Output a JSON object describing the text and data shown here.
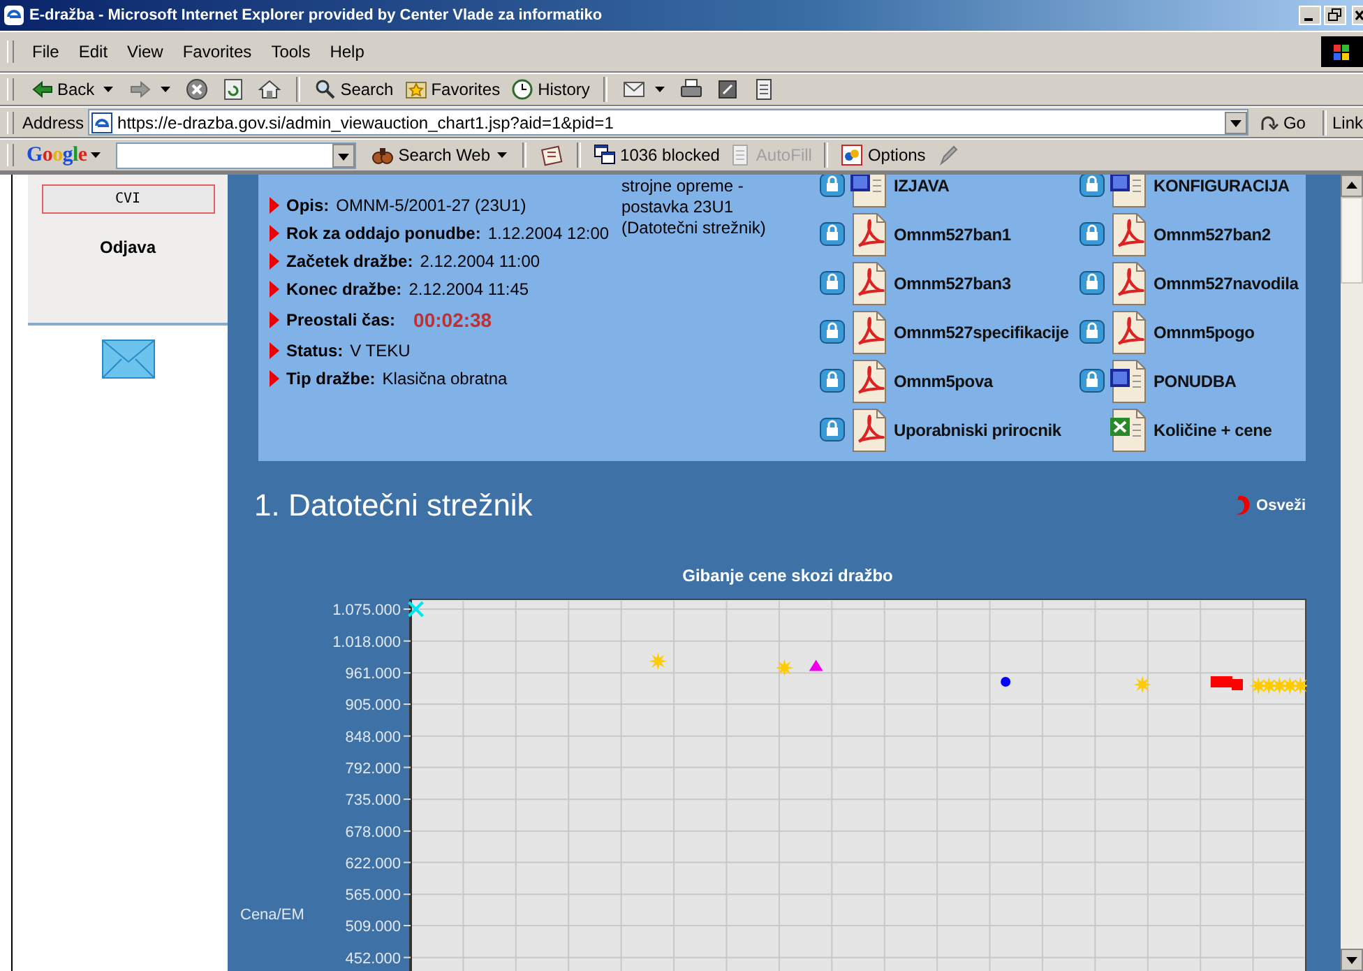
{
  "window": {
    "title": "E-dražba - Microsoft Internet Explorer provided by Center Vlade za informatiko"
  },
  "menu": [
    "File",
    "Edit",
    "View",
    "Favorites",
    "Tools",
    "Help"
  ],
  "toolbar": [
    {
      "kind": "back",
      "label": "Back"
    },
    {
      "kind": "forward"
    },
    {
      "kind": "stop"
    },
    {
      "kind": "refresh"
    },
    {
      "kind": "home"
    },
    {
      "kind": "search",
      "label": "Search"
    },
    {
      "kind": "favorites",
      "label": "Favorites"
    },
    {
      "kind": "history",
      "label": "History"
    },
    {
      "kind": "mail"
    },
    {
      "kind": "print"
    },
    {
      "kind": "edit"
    },
    {
      "kind": "discuss"
    }
  ],
  "address_bar": {
    "label": "Address",
    "value": "https://e-drazba.gov.si/admin_viewauction_chart1.jsp?aid=1&pid=1",
    "go": "Go",
    "links": "Link"
  },
  "google_bar": {
    "logo": "Google",
    "items": [
      {
        "kind": "search",
        "label": "Search Web",
        "disabled": false
      },
      {
        "kind": "news",
        "disabled": false
      },
      {
        "kind": "popup",
        "label": "1036 blocked",
        "disabled": false
      },
      {
        "kind": "autofill",
        "label": "AutoFill",
        "disabled": true
      },
      {
        "kind": "options",
        "label": "Options",
        "disabled": false
      },
      {
        "kind": "highlight",
        "disabled": false
      }
    ]
  },
  "sidebar": {
    "button": "CVI",
    "link": "Odjava"
  },
  "auction": {
    "fields": [
      {
        "kind": "text",
        "label": "Opis:",
        "value": "OMNM-5/2001-27 (23U1)"
      },
      {
        "kind": "text",
        "label": "Rok za oddajo ponudbe:",
        "value": "1.12.2004 12:00"
      },
      {
        "kind": "text",
        "label": "Začetek dražbe:",
        "value": "2.12.2004 11:00"
      },
      {
        "kind": "text",
        "label": "Konec dražbe:",
        "value": "2.12.2004 11:45"
      },
      {
        "kind": "timer",
        "label": "Preostali čas:",
        "value": "00:02:38"
      },
      {
        "kind": "text",
        "label": "Status:",
        "value": "V TEKU"
      },
      {
        "kind": "text",
        "label": "Tip dražbe:",
        "value": "Klasična obratna"
      }
    ],
    "description_lines": [
      "strojne opreme -",
      "postavka 23U1",
      "(Datotečni strežnik)"
    ],
    "documents": [
      {
        "name": "IZJAVA",
        "kind": "word",
        "locked": true
      },
      {
        "name": "KONFIGURACIJA",
        "kind": "word",
        "locked": true
      },
      {
        "name": "Omnm527ban1",
        "kind": "pdf",
        "locked": true
      },
      {
        "name": "Omnm527ban2",
        "kind": "pdf",
        "locked": true
      },
      {
        "name": "Omnm527ban3",
        "kind": "pdf",
        "locked": true
      },
      {
        "name": "Omnm527navodila",
        "kind": "pdf",
        "locked": true
      },
      {
        "name": "Omnm527specifikacije",
        "kind": "pdf",
        "locked": true
      },
      {
        "name": "Omnm5pogo",
        "kind": "pdf",
        "locked": true
      },
      {
        "name": "Omnm5pova",
        "kind": "pdf",
        "locked": true
      },
      {
        "name": "PONUDBA",
        "kind": "word",
        "locked": true
      },
      {
        "name": "Uporabniski prirocnik",
        "kind": "pdf",
        "locked": true
      },
      {
        "name": "Količine + cene",
        "kind": "excel",
        "locked": false
      }
    ]
  },
  "section": {
    "title": "1. Datotečni strežnik",
    "refresh": "Osveži",
    "chart_data": {
      "type": "scatter",
      "title": "Gibanje cene skozi dražbo",
      "ylabel": "Cena/EM",
      "ylim": [
        0,
        1092500
      ],
      "grid": true,
      "categories": [
        null,
        null,
        null,
        null,
        null,
        null,
        null,
        null,
        null,
        null,
        null,
        null,
        null,
        null,
        null,
        null,
        null,
        null,
        null,
        null,
        null,
        null,
        null,
        null,
        null,
        null,
        null,
        null,
        null,
        null,
        null,
        null,
        null,
        null,
        null,
        null,
        null,
        null,
        null,
        null,
        null,
        null,
        null,
        null,
        null,
        null,
        null,
        null,
        null,
        null,
        null,
        null,
        null,
        null,
        null,
        null,
        null,
        null,
        null,
        null,
        null,
        null,
        null,
        null,
        null,
        null,
        null,
        null,
        null,
        null,
        null,
        null,
        null,
        null,
        null,
        null,
        null,
        null,
        null,
        null,
        null,
        null,
        null,
        null,
        null
      ],
      "yticks": [
        {
          "value": 1075000,
          "label": "1.075.000"
        },
        {
          "value": 1018000,
          "label": "1.018.000"
        },
        {
          "value": 961000,
          "label": "961.000"
        },
        {
          "value": 905000,
          "label": "905.000"
        },
        {
          "value": 848000,
          "label": "848.000"
        },
        {
          "value": 792000,
          "label": "792.000"
        },
        {
          "value": 735000,
          "label": "735.000"
        },
        {
          "value": 678000,
          "label": "678.000"
        },
        {
          "value": 622000,
          "label": "622.000"
        },
        {
          "value": 565000,
          "label": "565.000"
        },
        {
          "value": 509000,
          "label": "509.000"
        },
        {
          "value": 452000,
          "label": "452.000"
        }
      ],
      "series": [
        {
          "color": "#00e5ee",
          "marker": "cross",
          "values": [
            1075000,
            null,
            null,
            null,
            null,
            null,
            null,
            null,
            null,
            null,
            null,
            null,
            null,
            null,
            null,
            null,
            null,
            null,
            null,
            null,
            null,
            null,
            null,
            null,
            null,
            null,
            null,
            null,
            null,
            null,
            null,
            null,
            null,
            null,
            null,
            null,
            null,
            null,
            null,
            null,
            null,
            null,
            null,
            null,
            null,
            null,
            null,
            null,
            null,
            null,
            null,
            null,
            null,
            null,
            null,
            null,
            null,
            null,
            null,
            null,
            null,
            null,
            null,
            null,
            null,
            null,
            null,
            null,
            null,
            null,
            null,
            null,
            null,
            null,
            null,
            null,
            null,
            null,
            null,
            null,
            null,
            null,
            null,
            null,
            null
          ]
        },
        {
          "color": "#ffcc00",
          "marker": "star",
          "values": [
            null,
            null,
            null,
            null,
            null,
            null,
            null,
            null,
            null,
            null,
            null,
            null,
            null,
            null,
            null,
            null,
            null,
            null,
            null,
            null,
            null,
            null,
            null,
            982000,
            null,
            null,
            null,
            null,
            null,
            null,
            null,
            null,
            null,
            null,
            null,
            970000,
            null,
            null,
            null,
            null,
            null,
            null,
            null,
            null,
            null,
            null,
            null,
            null,
            null,
            null,
            null,
            null,
            null,
            null,
            null,
            null,
            null,
            null,
            null,
            null,
            null,
            null,
            null,
            null,
            null,
            null,
            null,
            null,
            null,
            940000,
            null,
            null,
            null,
            null,
            null,
            null,
            null,
            null,
            null,
            null,
            938000,
            938000,
            938000,
            938000,
            938000
          ]
        },
        {
          "color": "#ee00ee",
          "marker": "triangle",
          "values": [
            null,
            null,
            null,
            null,
            null,
            null,
            null,
            null,
            null,
            null,
            null,
            null,
            null,
            null,
            null,
            null,
            null,
            null,
            null,
            null,
            null,
            null,
            null,
            null,
            null,
            null,
            null,
            null,
            null,
            null,
            null,
            null,
            null,
            null,
            null,
            null,
            null,
            null,
            972000,
            null,
            null,
            null,
            null,
            null,
            null,
            null,
            null,
            null,
            null,
            null,
            null,
            null,
            null,
            null,
            null,
            null,
            null,
            null,
            null,
            null,
            null,
            null,
            null,
            null,
            null,
            null,
            null,
            null,
            null,
            null,
            null,
            null,
            null,
            null,
            null,
            null,
            null,
            null,
            null,
            null,
            null,
            null,
            null,
            null,
            null
          ]
        },
        {
          "color": "#0000ff",
          "marker": "circle",
          "values": [
            null,
            null,
            null,
            null,
            null,
            null,
            null,
            null,
            null,
            null,
            null,
            null,
            null,
            null,
            null,
            null,
            null,
            null,
            null,
            null,
            null,
            null,
            null,
            null,
            null,
            null,
            null,
            null,
            null,
            null,
            null,
            null,
            null,
            null,
            null,
            null,
            null,
            null,
            null,
            null,
            null,
            null,
            null,
            null,
            null,
            null,
            null,
            null,
            null,
            null,
            null,
            null,
            null,
            null,
            null,
            null,
            945000,
            null,
            null,
            null,
            null,
            null,
            null,
            null,
            null,
            null,
            null,
            null,
            null,
            null,
            null,
            null,
            null,
            null,
            null,
            null,
            null,
            null,
            null,
            null,
            null,
            null,
            null,
            null,
            null
          ]
        },
        {
          "color": "#ff0000",
          "marker": "square",
          "values": [
            null,
            null,
            null,
            null,
            null,
            null,
            null,
            null,
            null,
            null,
            null,
            null,
            null,
            null,
            null,
            null,
            null,
            null,
            null,
            null,
            null,
            null,
            null,
            null,
            null,
            null,
            null,
            null,
            null,
            null,
            null,
            null,
            null,
            null,
            null,
            null,
            null,
            null,
            null,
            null,
            null,
            null,
            null,
            null,
            null,
            null,
            null,
            null,
            null,
            null,
            null,
            null,
            null,
            null,
            null,
            null,
            null,
            null,
            null,
            null,
            null,
            null,
            null,
            null,
            null,
            null,
            null,
            null,
            null,
            null,
            null,
            null,
            null,
            null,
            null,
            null,
            945000,
            945000,
            940000,
            null,
            null,
            null,
            null,
            null,
            null
          ]
        }
      ]
    }
  }
}
